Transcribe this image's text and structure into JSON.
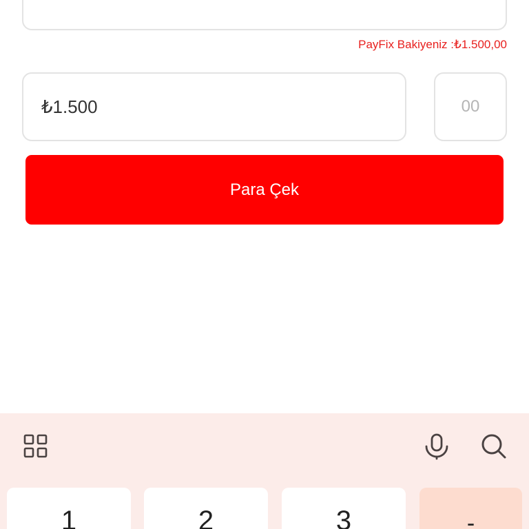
{
  "form": {
    "top_field_value": "",
    "balance_label": "PayFix Bakiyeniz :₺1.500,00",
    "amount_value": "₺1.500",
    "decimal_placeholder": "00",
    "withdraw_button_label": "Para Çek"
  },
  "keyboard": {
    "toolbar_icons": [
      "grid-icon",
      "microphone-icon",
      "search-icon"
    ],
    "keys": [
      "1",
      "2",
      "3",
      "-"
    ]
  },
  "colors": {
    "accent_red": "#ff0000",
    "balance_text": "#e8201e",
    "keyboard_background": "#fcece9",
    "function_key": "#fddccf"
  }
}
